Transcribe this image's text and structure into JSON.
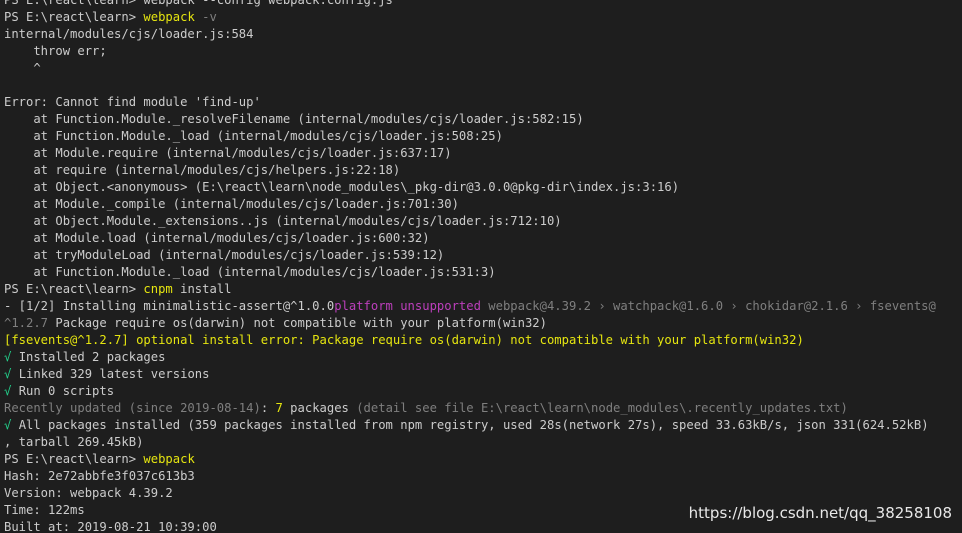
{
  "terminal": {
    "lines": [
      [
        {
          "t": "PS E:\\react\\learn> webpack --config webpack.config.js ",
          "c": "default"
        }
      ],
      [
        {
          "t": "PS E:\\react\\learn> ",
          "c": "default"
        },
        {
          "t": "webpack",
          "c": "yellow"
        },
        {
          "t": " -v",
          "c": "gray"
        }
      ],
      [
        {
          "t": "internal/modules/cjs/loader.js:584",
          "c": "default"
        }
      ],
      [
        {
          "t": "    throw err;",
          "c": "default"
        }
      ],
      [
        {
          "t": "    ^",
          "c": "default"
        }
      ],
      [
        {
          "t": "",
          "c": "default"
        }
      ],
      [
        {
          "t": "Error: Cannot find module 'find-up'",
          "c": "default"
        }
      ],
      [
        {
          "t": "    at Function.Module._resolveFilename (internal/modules/cjs/loader.js:582:15)",
          "c": "default"
        }
      ],
      [
        {
          "t": "    at Function.Module._load (internal/modules/cjs/loader.js:508:25)",
          "c": "default"
        }
      ],
      [
        {
          "t": "    at Module.require (internal/modules/cjs/loader.js:637:17)",
          "c": "default"
        }
      ],
      [
        {
          "t": "    at require (internal/modules/cjs/helpers.js:22:18)",
          "c": "default"
        }
      ],
      [
        {
          "t": "    at Object.<anonymous> (E:\\react\\learn\\node_modules\\_pkg-dir@3.0.0@pkg-dir\\index.js:3:16)",
          "c": "default"
        }
      ],
      [
        {
          "t": "    at Module._compile (internal/modules/cjs/loader.js:701:30)",
          "c": "default"
        }
      ],
      [
        {
          "t": "    at Object.Module._extensions..js (internal/modules/cjs/loader.js:712:10)",
          "c": "default"
        }
      ],
      [
        {
          "t": "    at Module.load (internal/modules/cjs/loader.js:600:32)",
          "c": "default"
        }
      ],
      [
        {
          "t": "    at tryModuleLoad (internal/modules/cjs/loader.js:539:12)",
          "c": "default"
        }
      ],
      [
        {
          "t": "    at Function.Module._load (internal/modules/cjs/loader.js:531:3)",
          "c": "default"
        }
      ],
      [
        {
          "t": "PS E:\\react\\learn> ",
          "c": "default"
        },
        {
          "t": "cnpm",
          "c": "yellow"
        },
        {
          "t": " install",
          "c": "default"
        }
      ],
      [
        {
          "t": "- [1/2] Installing minimalistic-assert@^1.0.0",
          "c": "default"
        },
        {
          "t": "platform unsupported",
          "c": "magenta"
        },
        {
          "t": " webpack@4.39.2 › watchpack@1.6.0 › chokidar@2.1.6 › fsevents@",
          "c": "gray"
        }
      ],
      [
        {
          "t": "^1.2.7",
          "c": "gray"
        },
        {
          "t": " Package require os(darwin) not compatible with your platform(win32)",
          "c": "default"
        }
      ],
      [
        {
          "t": "[fsevents@^1.2.7] optional install error: Package require os(darwin) not compatible with your platform(win32)",
          "c": "orange"
        }
      ],
      [
        {
          "t": "√ ",
          "c": "green"
        },
        {
          "t": "Installed 2 packages",
          "c": "default"
        }
      ],
      [
        {
          "t": "√ ",
          "c": "green"
        },
        {
          "t": "Linked 329 latest versions",
          "c": "default"
        }
      ],
      [
        {
          "t": "√ ",
          "c": "green"
        },
        {
          "t": "Run 0 scripts",
          "c": "default"
        }
      ],
      [
        {
          "t": "Recently updated (since 2019-08-14)",
          "c": "gray"
        },
        {
          "t": ": ",
          "c": "default"
        },
        {
          "t": "7",
          "c": "yellow"
        },
        {
          "t": " packages ",
          "c": "default"
        },
        {
          "t": "(detail see file E:\\react\\learn\\node_modules\\.recently_updates.txt)",
          "c": "gray"
        }
      ],
      [
        {
          "t": "√ ",
          "c": "green"
        },
        {
          "t": "All packages installed (359 packages installed from npm registry, used 28s(network 27s), speed 33.63kB/s, json 331(624.52kB)",
          "c": "default"
        }
      ],
      [
        {
          "t": ", tarball 269.45kB)",
          "c": "default"
        }
      ],
      [
        {
          "t": "PS E:\\react\\learn> ",
          "c": "default"
        },
        {
          "t": "webpack",
          "c": "yellow"
        }
      ],
      [
        {
          "t": "Hash: 2e72abbfe3f037c613b3",
          "c": "default"
        }
      ],
      [
        {
          "t": "Version: webpack 4.39.2",
          "c": "default"
        }
      ],
      [
        {
          "t": "Time: 122ms",
          "c": "default"
        }
      ],
      [
        {
          "t": "Built at: 2019-08-21 10:39:00",
          "c": "default"
        }
      ]
    ]
  },
  "watermark": "https://blog.csdn.net/qq_38258108"
}
